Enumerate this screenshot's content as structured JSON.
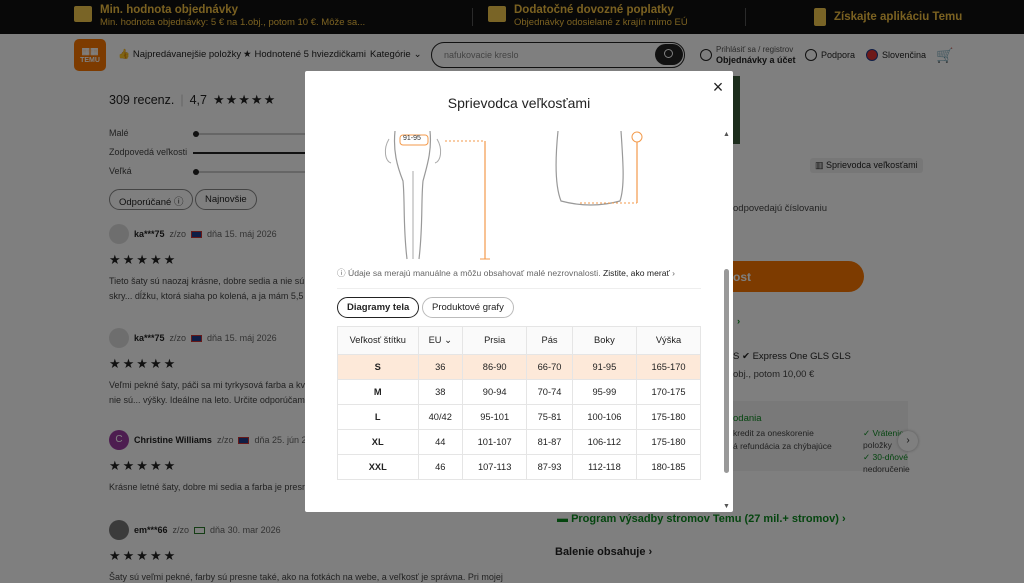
{
  "promo": [
    {
      "title": "Min. hodnota objednávky",
      "sub": "Min. hodnota objednávky: 5 € na 1.obj., potom 10 €. Môže sa..."
    },
    {
      "title": "Dodatočné dovozné poplatky",
      "sub": "Objednávky odosielané z krajín mimo EÚ"
    },
    {
      "title": "Získajte aplikáciu Temu",
      "sub": ""
    }
  ],
  "header": {
    "logo_text": "TEMU",
    "nav": [
      "Najpredávanejšie položky",
      "Hodnotené 5 hviezdičkami",
      "Kategórie"
    ],
    "search_placeholder": "nafukovacie kreslo",
    "account_top": "Prihlásiť sa / registrov",
    "account_bottom": "Objednávky a účet",
    "support": "Podpora",
    "language": "Slovenčina"
  },
  "reviews": {
    "count": "309 recenz.",
    "rating": "4,7",
    "fit": [
      "Malé",
      "Zodpovedá veľkosti",
      "Veľká"
    ],
    "filters": [
      "Odporúčané",
      "Najnovšie"
    ],
    "items": [
      {
        "user": "ka***75",
        "loc": "z/zo",
        "date": "dňa 15. máj 2026",
        "text": "Tieto šaty sú naozaj krásne, dobre sedia a nie sú j... odtieňovanú tyrkysovú farbu. Sú voľné, takže skry... dĺžku, ktorá siaha po kolená, a ja mám 5,5 stopy v..."
      },
      {
        "user": "ka***75",
        "loc": "z/zo",
        "date": "dňa 15. máj 2026",
        "text": "Veľmi pekné šaty, páči sa mi tyrkysová farba a kvet... voľné a dobre zakrývajú bruško, okolo krku nie sú... výšky. Ideálne na leto. Určite odporúčam."
      },
      {
        "user": "Christine Williams",
        "avatar": "C",
        "loc": "z/zo",
        "date": "dňa 25. jún 2025",
        "text": "Krásne letné šaty, dobre mi sedia a farba je presne... veľmi spokojná."
      },
      {
        "user": "em***66",
        "loc": "z/zo",
        "date": "dňa 30. mar 2026",
        "text": "Šaty sú veľmi pekné, farby sú presne také, ako na fotkách na webe, a veľkosť je správna. Pri mojej"
      }
    ]
  },
  "right": {
    "size_guide_chip": "Sprievodca veľkosťami",
    "sizing_note": "odpovedajú číslovaniu",
    "add_button": "ost",
    "shipping": "S ✔ Express One GLS GLS",
    "min_order": "obj., potom 10,00 €",
    "delivery_title": "odania",
    "delivery_l1": "kredit za oneskorenie",
    "delivery_l2": "á refundácia za chýbajúce",
    "delivery_l3": "",
    "returns_l1": "✓ Vrátenie",
    "returns_l2": "položky",
    "returns_l3": "✓ 30-dňové",
    "returns_l4": "nedoručenie",
    "tree_program": "Program výsadby stromov Temu (27 mil.+ stromov)",
    "package": "Balenie obsahuje"
  },
  "modal": {
    "title": "Sprievodca veľkosťami",
    "close": "×",
    "illus_label": "91-95",
    "note": "Údaje sa merajú manuálne a môžu obsahovať malé nezrovnalosti.",
    "note_link": "Zistite, ako merať",
    "tabs": [
      "Diagramy tela",
      "Produktové grafy"
    ],
    "headers": [
      "Veľkosť štítku",
      "EU",
      "Prsia",
      "Pás",
      "Boky",
      "Výška"
    ],
    "rows": [
      [
        "S",
        "36",
        "86-90",
        "66-70",
        "91-95",
        "165-170"
      ],
      [
        "M",
        "38",
        "90-94",
        "70-74",
        "95-99",
        "170-175"
      ],
      [
        "L",
        "40/42",
        "95-101",
        "75-81",
        "100-106",
        "175-180"
      ],
      [
        "XL",
        "44",
        "101-107",
        "81-87",
        "106-112",
        "175-180"
      ],
      [
        "XXL",
        "46",
        "107-113",
        "87-93",
        "112-118",
        "180-185"
      ]
    ],
    "selected_row": 0
  },
  "colors": {
    "accent": "#fb7701",
    "promo_text": "#f5c242",
    "selected_row": "#fde9d9"
  }
}
